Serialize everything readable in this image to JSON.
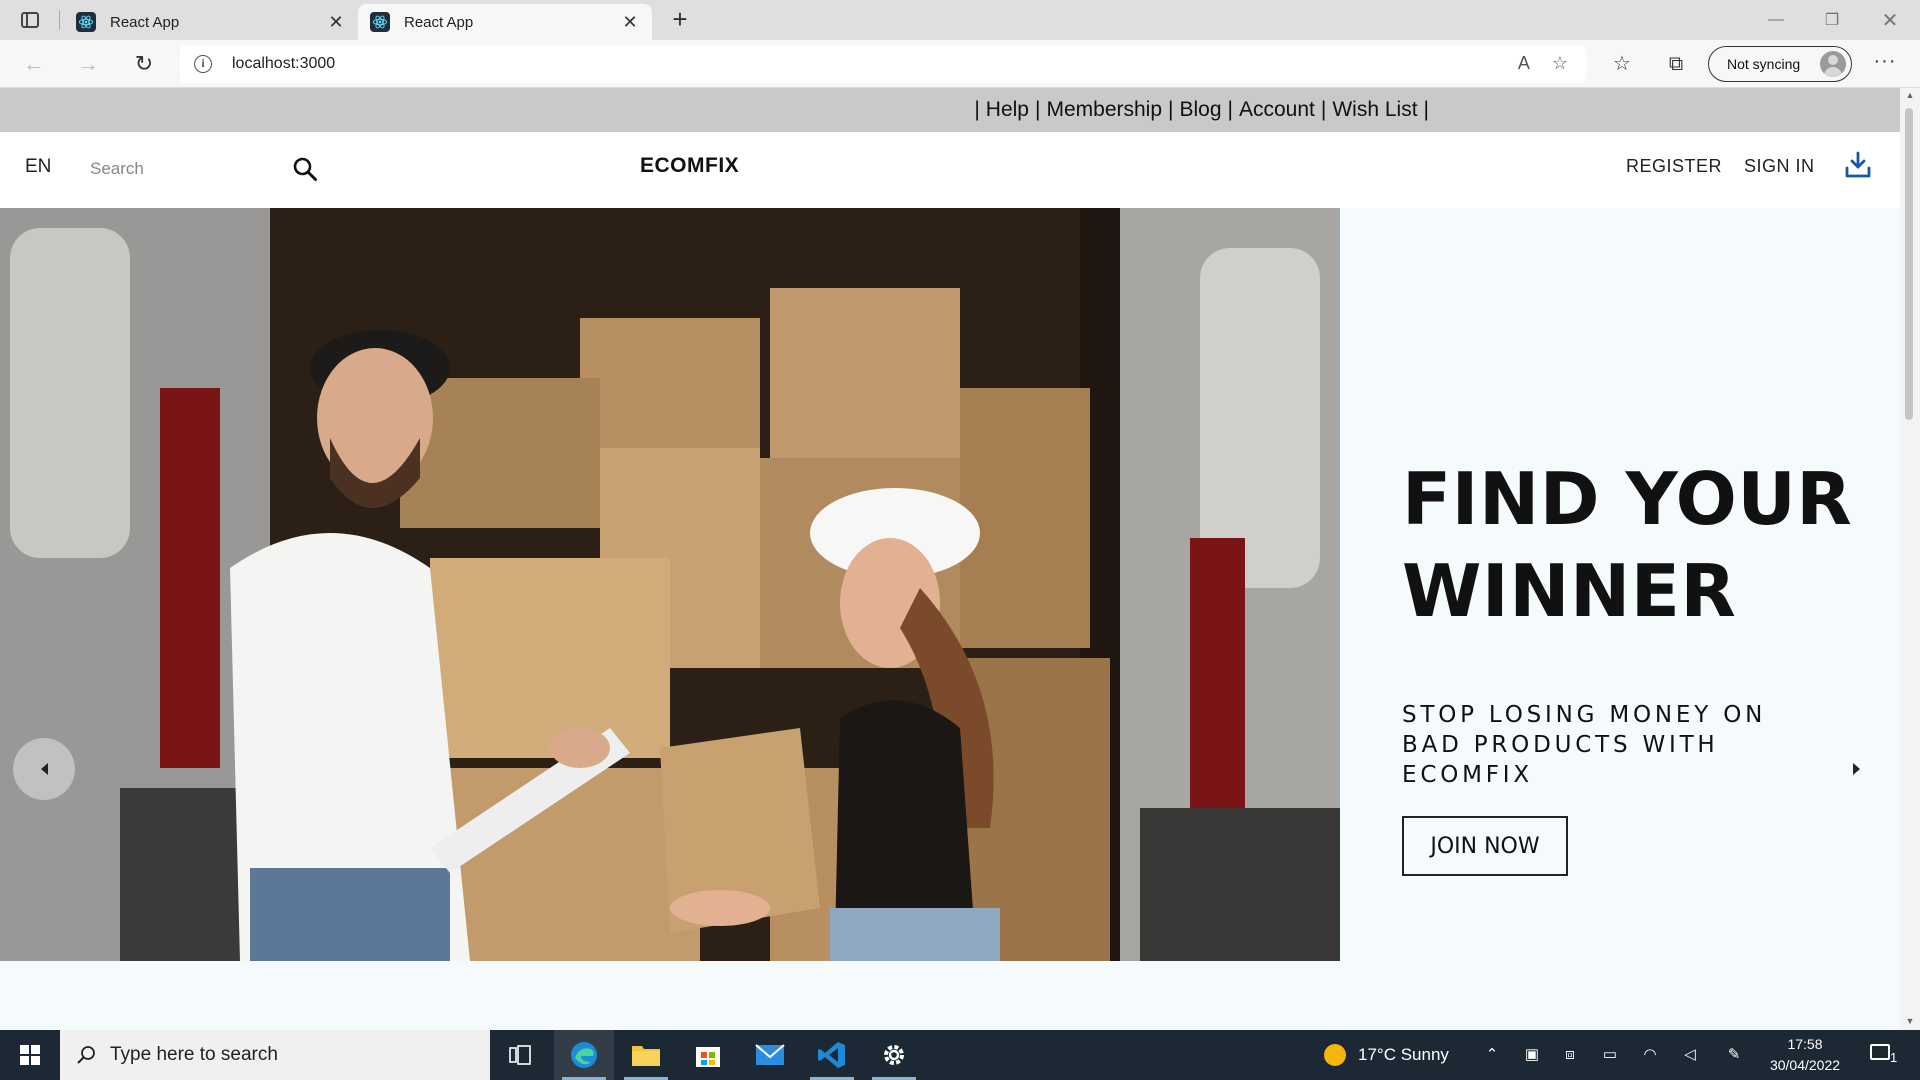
{
  "browser": {
    "tabs": [
      {
        "title": "React App",
        "active": false
      },
      {
        "title": "React App",
        "active": true
      }
    ],
    "new_tab": "+",
    "address": "localhost:3000",
    "sync_label": "Not syncing"
  },
  "site": {
    "top_links": [
      "Help",
      "Membership",
      "Blog",
      "Account",
      "Wish List"
    ],
    "separator": "|",
    "language": "EN",
    "search_placeholder": "Search",
    "brand": "ECOMFIX",
    "register": "REGISTER",
    "sign_in": "SIGN IN",
    "hero": {
      "title_line1": "FIND YOUR",
      "title_line2": "WINNER",
      "subtitle": "STOP LOSING MONEY ON BAD PRODUCTS WITH ECOMFIX",
      "cta": "JOIN NOW",
      "image_alt": "Delivery workers with cardboard boxes in a van"
    }
  },
  "taskbar": {
    "search_placeholder": "Type here to search",
    "weather": "17°C  Sunny",
    "time": "17:58",
    "date": "30/04/2022",
    "notifications": "1"
  },
  "colors": {
    "announce_bar": "#c9c9c9",
    "accent_download": "#1a56a8",
    "taskbar": "#1c2833",
    "page_bg": "#f5fafd"
  }
}
